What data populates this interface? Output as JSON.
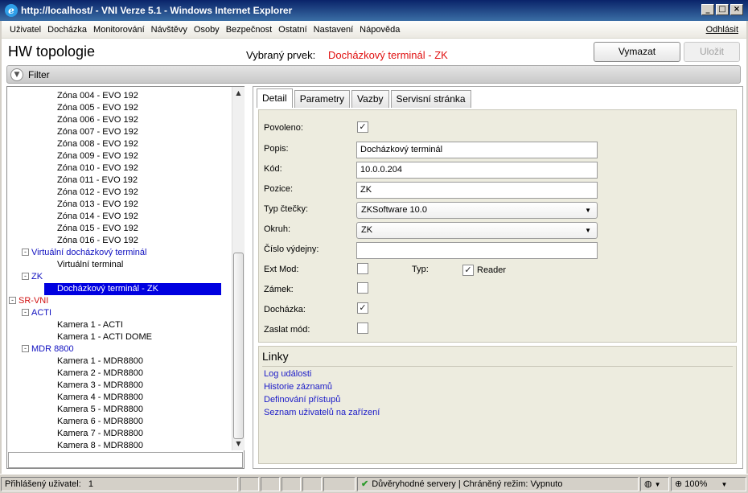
{
  "window": {
    "title": "http://localhost/ - VNI Verze 5.1 - Windows Internet Explorer",
    "minimize_icon": "minimize-icon",
    "maximize_icon": "maximize-icon",
    "close_icon": "close-icon"
  },
  "menu": {
    "items": [
      "Uživatel",
      "Docházka",
      "Monitorování",
      "Návštěvy",
      "Osoby",
      "Bezpečnost",
      "Ostatní",
      "Nastavení",
      "Nápověda"
    ],
    "logout": "Odhlásit"
  },
  "header": {
    "title": "HW topologie",
    "selected_label": "Vybraný prvek:",
    "selected_value": "Docházkový terminál - ZK",
    "delete_button": "Vymazat",
    "save_button": "Uložit"
  },
  "filter": {
    "label": "Filter"
  },
  "tree": {
    "items": [
      {
        "label": "Zóna 004 - EVO 192",
        "level": 3
      },
      {
        "label": "Zóna 005 - EVO 192",
        "level": 3
      },
      {
        "label": "Zóna 006 - EVO 192",
        "level": 3
      },
      {
        "label": "Zóna 007 - EVO 192",
        "level": 3
      },
      {
        "label": "Zóna 008 - EVO 192",
        "level": 3
      },
      {
        "label": "Zóna 009 - EVO 192",
        "level": 3
      },
      {
        "label": "Zóna 010 - EVO 192",
        "level": 3
      },
      {
        "label": "Zóna 011 - EVO 192",
        "level": 3
      },
      {
        "label": "Zóna 012 - EVO 192",
        "level": 3
      },
      {
        "label": "Zóna 013 - EVO 192",
        "level": 3
      },
      {
        "label": "Zóna 014 - EVO 192",
        "level": 3
      },
      {
        "label": "Zóna 015 - EVO 192",
        "level": 3
      },
      {
        "label": "Zóna 016 - EVO 192",
        "level": 3
      },
      {
        "label": "Virtuální docházkový terminál",
        "level": 2,
        "toggle": "-",
        "color": "blue"
      },
      {
        "label": "Virtuální terminal",
        "level": 3
      },
      {
        "label": "ZK",
        "level": 2,
        "toggle": "-",
        "color": "blue"
      },
      {
        "label": "Docházkový terminál - ZK",
        "level": 3,
        "selected": true
      },
      {
        "label": "SR-VNI",
        "level": 1,
        "toggle": "-",
        "color": "red"
      },
      {
        "label": "ACTI",
        "level": 2,
        "toggle": "-",
        "color": "blue"
      },
      {
        "label": "Kamera 1 - ACTI",
        "level": 3
      },
      {
        "label": "Kamera 1 - ACTI DOME",
        "level": 3
      },
      {
        "label": "MDR 8800",
        "level": 2,
        "toggle": "-",
        "color": "blue"
      },
      {
        "label": "Kamera 1 - MDR8800",
        "level": 3
      },
      {
        "label": "Kamera 2 - MDR8800",
        "level": 3
      },
      {
        "label": "Kamera 3 - MDR8800",
        "level": 3
      },
      {
        "label": "Kamera 4 - MDR8800",
        "level": 3
      },
      {
        "label": "Kamera 5 - MDR8800",
        "level": 3
      },
      {
        "label": "Kamera 6 - MDR8800",
        "level": 3
      },
      {
        "label": "Kamera 7 - MDR8800",
        "level": 3
      },
      {
        "label": "Kamera 8 - MDR8800",
        "level": 3
      }
    ],
    "search_value": ""
  },
  "tabs": [
    "Detail",
    "Parametry",
    "Vazby",
    "Servisní stránka"
  ],
  "detail": {
    "enabled_label": "Povoleno:",
    "enabled": true,
    "description_label": "Popis:",
    "description_value": "Docházkový terminál",
    "code_label": "Kód:",
    "code_value": "10.0.0.204",
    "position_label": "Pozice:",
    "position_value": "ZK",
    "reader_type_label": "Typ čtečky:",
    "reader_type_value": "ZKSoftware 10.0",
    "circuit_label": "Okruh:",
    "circuit_value": "ZK",
    "dispense_label": "Číslo výdejny:",
    "dispense_value": "",
    "ext_mod_label": "Ext Mod:",
    "ext_mod": false,
    "type_label": "Typ:",
    "reader_label": "Reader",
    "reader": true,
    "lock_label": "Zámek:",
    "lock": false,
    "attendance_label": "Docházka:",
    "attendance": true,
    "send_mode_label": "Zaslat mód:",
    "send_mode": false
  },
  "links": {
    "title": "Linky",
    "items": [
      "Log události",
      "Historie záznamů",
      "Definování přístupů",
      "Seznam uživatelů na zařízení"
    ]
  },
  "status": {
    "user_label": "Přihlášený uživatel:",
    "user_value": "1",
    "trust_text": "Důvěryhodné servery | Chráněný režim: Vypnuto",
    "zoom": "100%"
  }
}
